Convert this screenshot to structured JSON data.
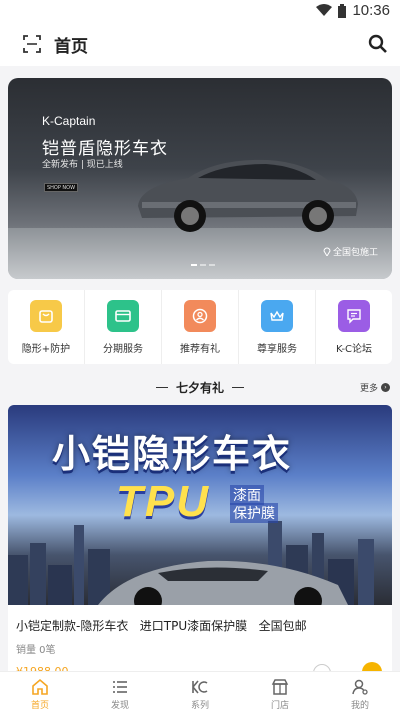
{
  "status_bar": {
    "time": "10:36"
  },
  "app_bar": {
    "title": "首页"
  },
  "banner": {
    "brand": "K-Captain",
    "headline": "铠普盾隐形车衣",
    "subline": "全新发布 | 现已上线",
    "shop_button": "SHOP NOW",
    "location": "全国包施工"
  },
  "quick_menu": [
    {
      "label": "隐形+防护",
      "icon": "bag-icon",
      "color": "#f7c948"
    },
    {
      "label": "分期服务",
      "icon": "card-icon",
      "color": "#2dc28a"
    },
    {
      "label": "推荐有礼",
      "icon": "user-gift-icon",
      "color": "#f28a5b"
    },
    {
      "label": "尊享服务",
      "icon": "crown-icon",
      "color": "#4aa8f0"
    },
    {
      "label": "K-C论坛",
      "icon": "chat-icon",
      "color": "#9b5de5"
    }
  ],
  "section": {
    "title": "七夕有礼",
    "more": "更多"
  },
  "product": {
    "poster_title": "小铠隐形车衣",
    "poster_tpu": "TPU",
    "poster_sub1": "漆面",
    "poster_sub2": "保护膜",
    "name": "小铠定制款-隐形车衣   进口TPU漆面保护膜   全国包邮",
    "sales": "销量 0笔",
    "price": "¥1988.00"
  },
  "tabbar": [
    {
      "label": "首页",
      "icon": "home-icon",
      "active": true
    },
    {
      "label": "发现",
      "icon": "list-icon",
      "active": false
    },
    {
      "label": "系列",
      "icon": "kc-logo-icon",
      "active": false
    },
    {
      "label": "门店",
      "icon": "store-icon",
      "active": false
    },
    {
      "label": "我的",
      "icon": "profile-icon",
      "active": false
    }
  ],
  "colors": {
    "accent": "#f5a623",
    "background": "#f4f4f6"
  }
}
